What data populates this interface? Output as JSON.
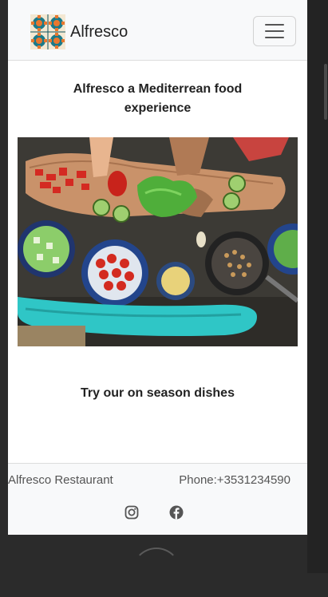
{
  "navbar": {
    "brand": "Alfresco",
    "logo_icon": "tile-logo-icon",
    "menu_icon": "hamburger-menu-icon"
  },
  "main": {
    "headline": "Alfresco a Mediterrean food experience",
    "dishes_heading": "Try our on season dishes"
  },
  "footer": {
    "restaurant_name": "Alfresco Restaurant",
    "phone": "Phone:+3531234590",
    "social_icons": [
      "instagram-icon",
      "facebook-icon"
    ]
  },
  "colors": {
    "navbar_bg": "#f8f9fa",
    "logo_teal": "#1a7a8a",
    "logo_orange": "#e8772e",
    "page_bg": "#2b2b2b"
  }
}
